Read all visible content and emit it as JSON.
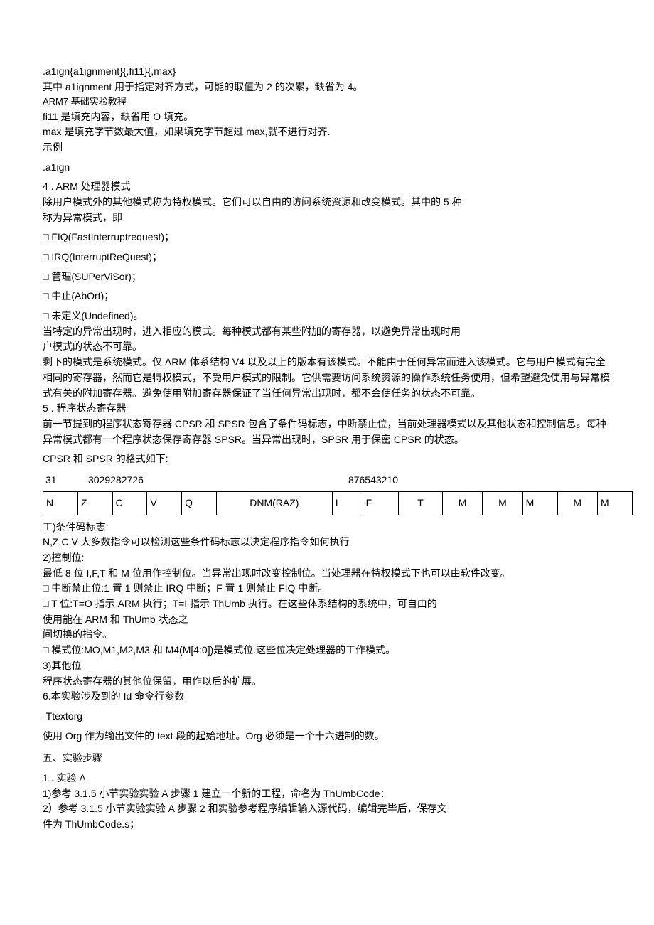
{
  "p1": {
    "l1": ".a1ign{a1ignment}{,fi11}{,max}",
    "l2": "其中 a1ignment 用于指定对齐方式，可能的取值为 2 的次累，缺省为 4。",
    "l3": "ARM7 基础实验教程",
    "l4": "fi11 是填充内容，缺省用 O 填充。",
    "l5": "max 是填充字节数最大值，如果填充字节超过 max,就不进行对齐.",
    "l6": "示例",
    "l7": ".a1ign"
  },
  "p2": {
    "l1": "4   . ARM 处理器模式",
    "l2": "除用户模式外的其他模式称为特权模式。它们可以自由的访问系统资源和改变模式。其中的 5 种",
    "l3": "称为异常模式，即",
    "l4": "□   FIQ(FastInterruptrequest)；",
    "l5": "□   IRQ(InterruptReQuest)；",
    "l6": "□   管理(SUPerViSor)；",
    "l7": "□   中止(AbOrt)；",
    "l8": "□   未定义(Undefined)。",
    "l9": "当特定的异常出现时，进入相应的模式。每种模式都有某些附加的寄存器，以避免异常出现时用",
    "l10": "户模式的状态不可靠。",
    "l11": "剩下的模式是系统模式。仅 ARM 体系结构 V4 以及以上的版本有该模式。不能由于任何异常而进入该模式。它与用户模式有完全相同的寄存器，然而它是特权模式，不受用户模式的限制。它供需要访问系统资源的操作系统任务使用，但希望避免使用与异常模式有关的附加寄存器。避免使用附加寄存器保证了当任何异常出现时，都不会使任务的状态不可靠。"
  },
  "p3": {
    "l1": "5   . 程序状态寄存器",
    "l2": "前一节提到的程序状态寄存器 CPSR 和 SPSR 包含了条件码标志，中断禁止位，当前处理器模式以及其他状态和控制信息。每种异常模式都有一个程序状态保存寄存器 SPSR。当异常出现时，SPSR 用于保密 CPSR 的状态。",
    "l3": "CPSR 和 SPSR 的格式如下:"
  },
  "bits": {
    "l31": "31",
    "lhigh": "3029282726",
    "llow": "876543210"
  },
  "table": {
    "r": [
      "N",
      "Z",
      "C",
      "V",
      "Q",
      "DNM(RAZ)",
      "I",
      "F",
      "T",
      "M",
      "M",
      "M",
      "M",
      "M"
    ]
  },
  "p4": {
    "l1": "工)条件码标志:",
    "l2": "N,Z,C,V 大多数指令可以检测这些条件码标志以决定程序指令如何执行",
    "l3": "2)控制位:",
    "l4": "最低 8 位 I,F,T 和 M 位用作控制位。当异常出现时改变控制位。当处理器在特权模式下也可以由软件改变。",
    "l5": "□   中断禁止位:1 置 1 则禁止 IRQ 中断；F 置 1 则禁止 FIQ 中断。",
    "l6": "□   T 位:T=O 指示 ARM 执行；T=I 指示 ThUmb 执行。在这些体系结构的系统中，可自由的",
    "l7": "使用能在 ARM 和 ThUmb 状态之",
    "l8": "间切换的指令。",
    "l9": "□   模式位:MO,M1,M2,M3 和 M4(M[4:0])是模式位.这些位决定处理器的工作模式。",
    "l10": "3)其他位",
    "l11": "程序状态寄存器的其他位保留，用作以后的扩展。",
    "l12": "6.本实验涉及到的 Id 命令行参数",
    "l13": "-Ttextorg",
    "l14": "使用 Org 作为输出文件的 text 段的起始地址。Org 必须是一个十六进制的数。"
  },
  "p5": {
    "l1": "五、实验步骤",
    "l2": "1  . 实验 A",
    "l3": "1)参考 3.1.5 小节实验实验 A 步骤 1 建立一个新的工程，命名为 ThUmbCode：",
    "l4": "2）参考 3.1.5 小节实验实验 A 步骤 2 和实验参考程序编辑输入源代码，编辑完毕后，保存文",
    "l5": "件为 ThUmbCode.s；"
  }
}
